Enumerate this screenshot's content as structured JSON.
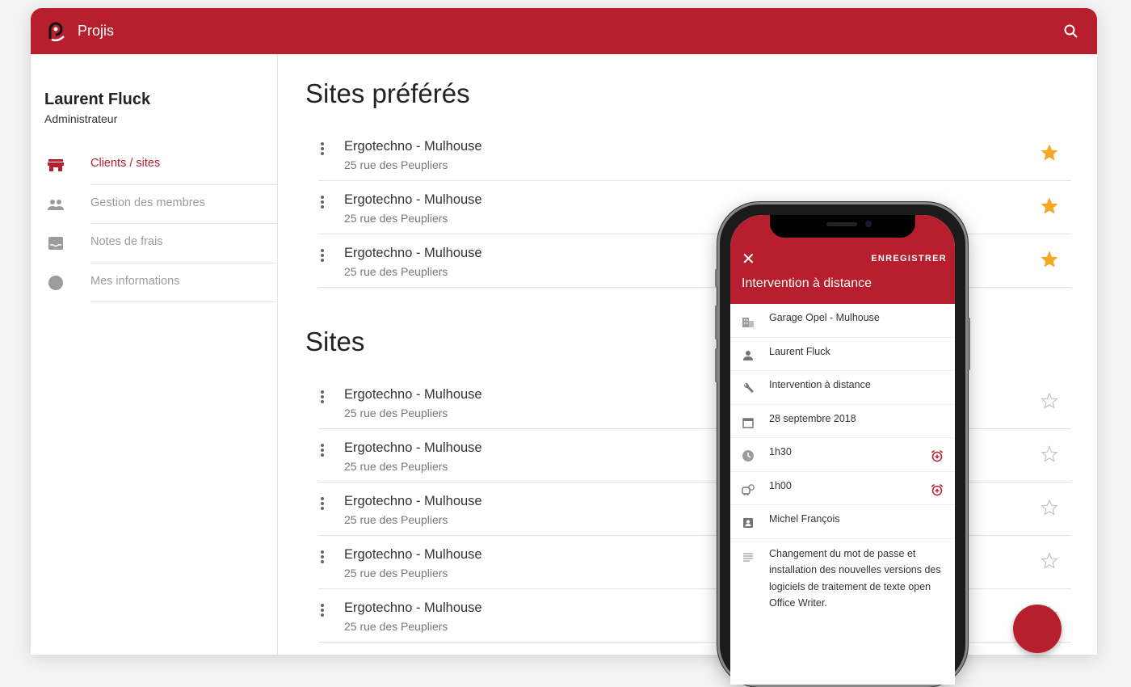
{
  "app": {
    "title": "Projis",
    "brand_color": "#b71f2e"
  },
  "user": {
    "name": "Laurent Fluck",
    "role": "Administrateur"
  },
  "nav": [
    {
      "label": "Clients / sites",
      "icon": "store-icon",
      "active": true
    },
    {
      "label": "Gestion des membres",
      "icon": "people-icon",
      "active": false
    },
    {
      "label": "Notes de frais",
      "icon": "inbox-icon",
      "active": false
    },
    {
      "label": "Mes informations",
      "icon": "account-circle-icon",
      "active": false
    }
  ],
  "favorites": {
    "title": "Sites préférés",
    "items": [
      {
        "name": "Ergotechno - Mulhouse",
        "address": "25 rue des Peupliers",
        "starred": true
      },
      {
        "name": "Ergotechno - Mulhouse",
        "address": "25 rue des Peupliers",
        "starred": true
      },
      {
        "name": "Ergotechno - Mulhouse",
        "address": "25 rue des Peupliers",
        "starred": true
      }
    ]
  },
  "sites": {
    "title": "Sites",
    "items": [
      {
        "name": "Ergotechno - Mulhouse",
        "address": "25 rue des Peupliers",
        "starred": false
      },
      {
        "name": "Ergotechno - Mulhouse",
        "address": "25 rue des Peupliers",
        "starred": false
      },
      {
        "name": "Ergotechno - Mulhouse",
        "address": "25 rue des Peupliers",
        "starred": false
      },
      {
        "name": "Ergotechno - Mulhouse",
        "address": "25 rue des Peupliers",
        "starred": false
      },
      {
        "name": "Ergotechno - Mulhouse",
        "address": "25 rue des Peupliers",
        "starred": false
      }
    ]
  },
  "phone": {
    "close_icon": "✕",
    "save_label": "ENREGISTRER",
    "title": "Intervention à distance",
    "fields": {
      "site": "Garage Opel - Mulhouse",
      "person": "Laurent Fluck",
      "type": "Intervention à distance",
      "date": "28 septembre 2018",
      "duration": "1h30",
      "travel": "1h00",
      "contact": "Michel François",
      "description": "Changement du mot de passe et installation des nouvelles versions des logiciels de traitement de texte open Office Writer."
    }
  },
  "colors": {
    "star_active": "#f5a623",
    "star_inactive": "#bdbdbd",
    "muted": "#9c9c9c"
  }
}
